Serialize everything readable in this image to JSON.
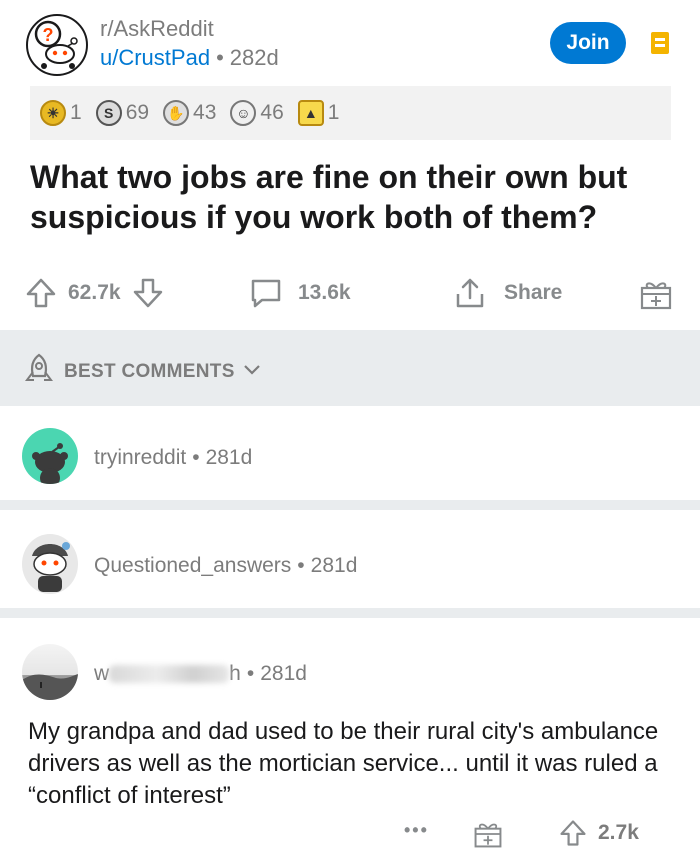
{
  "post": {
    "subreddit": "r/AskReddit",
    "author": "u/CrustPad",
    "separator": "•",
    "age": "282d",
    "join_label": "Join",
    "awards": [
      {
        "icon": "gold-award-icon",
        "count": "1",
        "color": "#e8b923"
      },
      {
        "icon": "silver-coin-award-icon",
        "count": "69",
        "color": "#dcdcdc"
      },
      {
        "icon": "helpful-award-icon",
        "count": "43",
        "color": "#e0e0e0"
      },
      {
        "icon": "wholesome-award-icon",
        "count": "46",
        "color": "#f0f0f0"
      },
      {
        "icon": "platinum-award-icon",
        "count": "1",
        "color": "#f7d94c"
      }
    ],
    "title": "What two jobs are fine on their own but suspicious if you work both of them?",
    "upvotes": "62.7k",
    "comments": "13.6k",
    "share_label": "Share"
  },
  "sort": {
    "label": "BEST COMMENTS"
  },
  "comments": [
    {
      "username": "tryinreddit",
      "age": "281d",
      "avatar_color": "#4bd6b1"
    },
    {
      "username": "Questioned_answers",
      "age": "281d",
      "avatar_color": "#e8e8e8"
    },
    {
      "username_start": "w",
      "username_end": "h",
      "age": "281d",
      "body": "My grandpa and dad used to be their rural city's ambulance drivers as well as the mortician service... until it was ruled a “conflict of interest”",
      "more_label": "•••",
      "upvotes": "2.7k"
    }
  ],
  "colors": {
    "accent": "#0079d3",
    "band": "#e9ecee",
    "muted": "#7c7c7c"
  }
}
